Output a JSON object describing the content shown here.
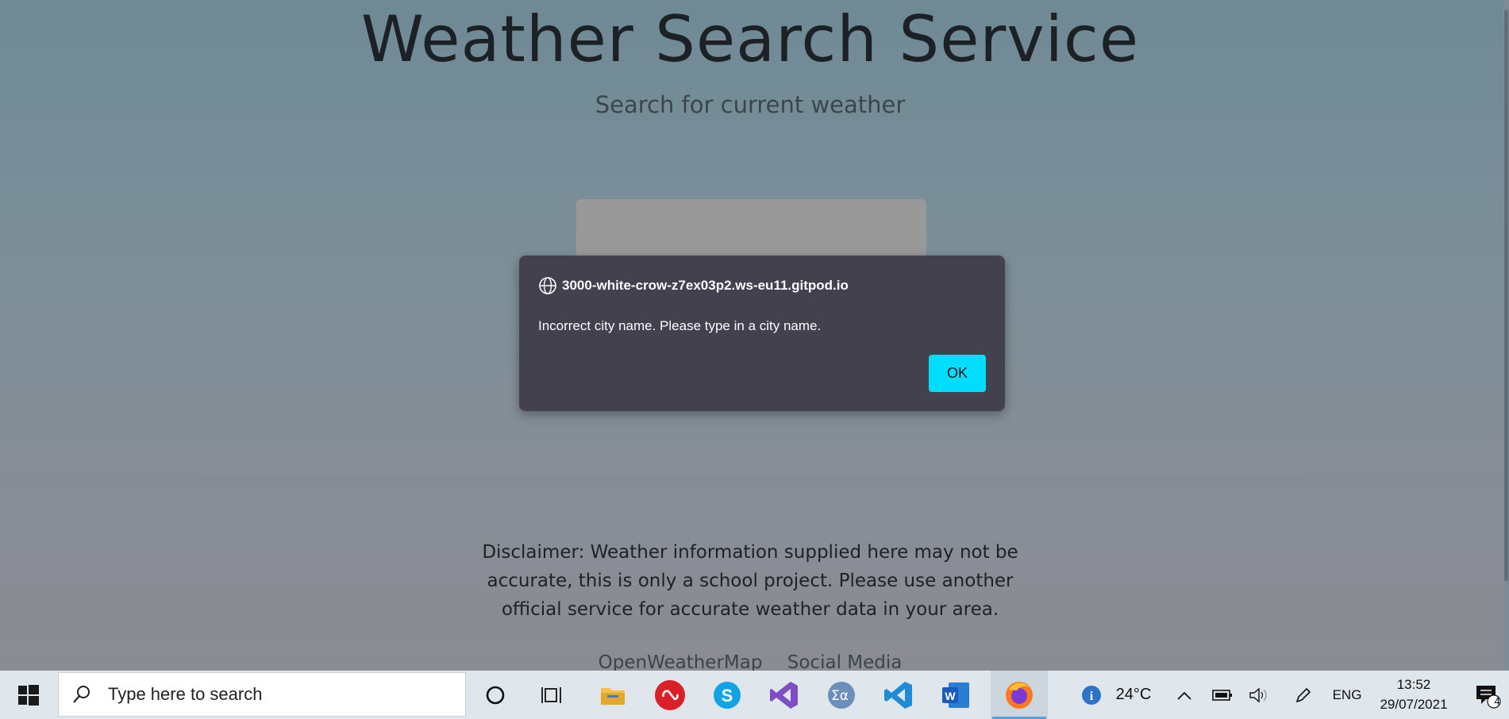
{
  "page": {
    "title": "Weather Search Service",
    "subtitle": "Search for current weather",
    "disclaimer": "Disclaimer: Weather information supplied here may not be accurate, this is only a school project. Please use another official service for accurate weather data in your area.",
    "footer_links": [
      "OpenWeatherMap",
      "Social Media"
    ]
  },
  "dialog": {
    "origin": "3000-white-crow-z7ex03p2.ws-eu11.gitpod.io",
    "message": "Incorrect city name. Please type in a city name.",
    "ok_label": "OK",
    "accent": "#00ddff"
  },
  "taskbar": {
    "search_placeholder": "Type here to search",
    "apps": [
      "cortana-icon",
      "task-view-icon",
      "file-explorer-icon",
      "adobe-creative-cloud-icon",
      "skype-icon",
      "visual-studio-icon",
      "math-input-icon",
      "vscode-icon",
      "word-icon",
      "firefox-icon"
    ],
    "weather_temp": "24°C",
    "language": "ENG",
    "time": "13:52",
    "date": "29/07/2021",
    "notification_count": "4"
  }
}
